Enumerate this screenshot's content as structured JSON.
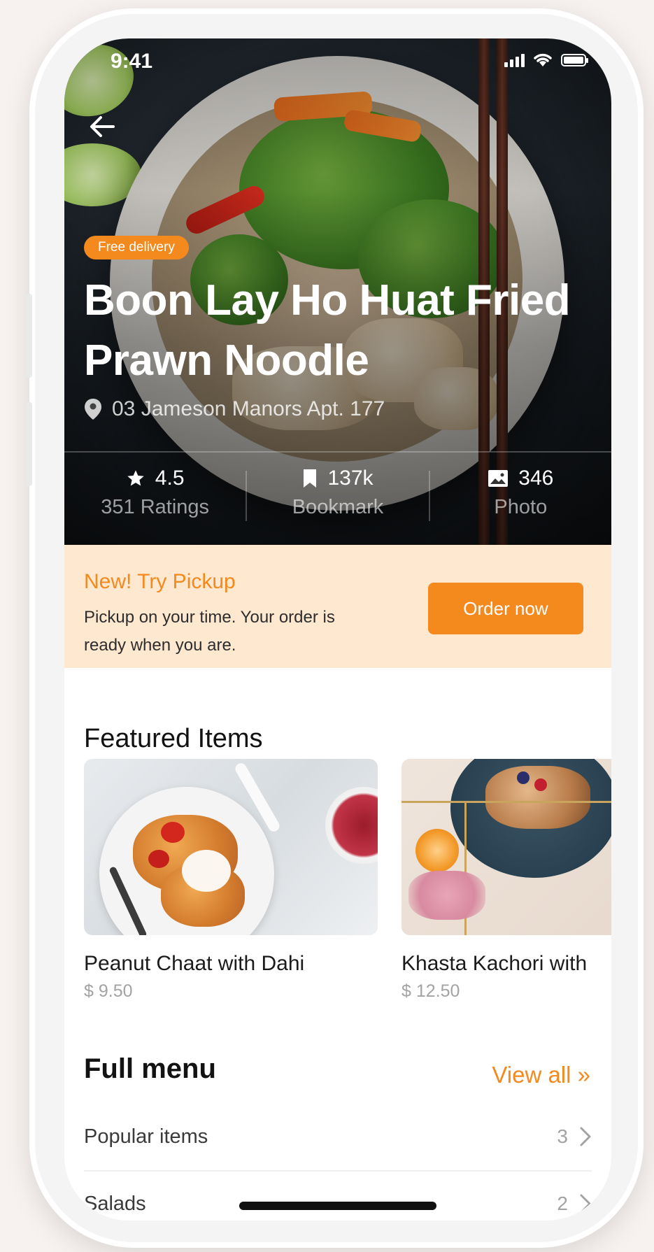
{
  "status_bar": {
    "time": "9:41"
  },
  "hero": {
    "badge": "Free delivery",
    "title_line1": "Boon Lay Ho Huat Fried",
    "title_line2": "Prawn Noodle",
    "address": "03 Jameson Manors Apt. 177",
    "stats": [
      {
        "value": "4.5",
        "label": "351 Ratings",
        "icon": "star-icon"
      },
      {
        "value": "137k",
        "label": "Bookmark",
        "icon": "bookmark-icon"
      },
      {
        "value": "346",
        "label": "Photo",
        "icon": "photo-icon"
      }
    ]
  },
  "pickup": {
    "title": "New! Try Pickup",
    "description": "Pickup on your time. Your order is ready when you are.",
    "button": "Order now"
  },
  "featured": {
    "title": "Featured Items",
    "items": [
      {
        "name": "Peanut Chaat with Dahi",
        "price": "$ 9.50"
      },
      {
        "name": "Khasta Kachori with",
        "price": "$ 12.50"
      }
    ]
  },
  "full_menu": {
    "title": "Full menu",
    "view_all": "View all »",
    "rows": [
      {
        "label": "Popular items",
        "count": "3"
      },
      {
        "label": "Salads",
        "count": "2"
      }
    ]
  },
  "colors": {
    "accent": "#f4891e",
    "pickup_bg": "#fee8d0",
    "text_primary": "#121212",
    "text_muted": "#a3a3a3"
  }
}
